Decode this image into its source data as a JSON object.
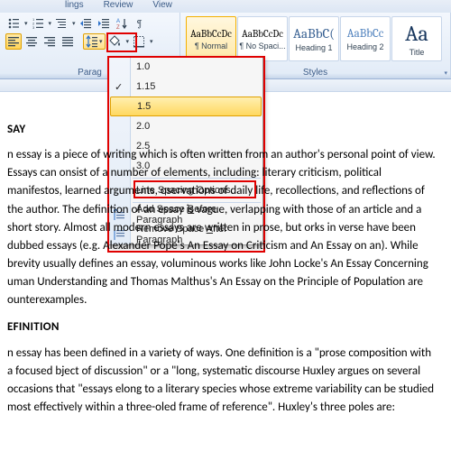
{
  "tabs": {
    "mailings": "lings",
    "review": "Review",
    "view": "View"
  },
  "ribbon": {
    "paragraph_label": "Parag",
    "styles_label": "Styles"
  },
  "styles": [
    {
      "preview": "AaBbCcDc",
      "name": "¶ Normal",
      "prevSize": "11px",
      "prevColor": "#000",
      "sel": true
    },
    {
      "preview": "AaBbCcDc",
      "name": "¶ No Spaci...",
      "prevSize": "11px",
      "prevColor": "#000"
    },
    {
      "preview": "AaBbC(",
      "name": "Heading 1",
      "prevSize": "15px",
      "prevColor": "#365f91"
    },
    {
      "preview": "AaBbCc",
      "name": "Heading 2",
      "prevSize": "13px",
      "prevColor": "#4f81bd"
    },
    {
      "preview": "Aa",
      "name": "Title",
      "prevSize": "24px",
      "prevColor": "#17365d"
    }
  ],
  "dropdown": {
    "items": [
      {
        "label": "1.0"
      },
      {
        "label": "1.15",
        "checked": true
      },
      {
        "label": "1.5",
        "hover": true
      },
      {
        "label": "2.0"
      },
      {
        "label": "2.5"
      },
      {
        "label": "3.0"
      }
    ],
    "line_spacing_options": "Line Spacing Options...",
    "add_before": "Add Space Before Paragraph",
    "add_before_accel": "B",
    "remove_after": "Remove Space After Paragraph",
    "remove_after_accel": "A"
  },
  "doc": {
    "h1": "SAY",
    "p1": "n essay is a piece of writing which is often written from an author's personal point of view. Essays can onsist of a number of elements, including: literary criticism, political manifestos, learned arguments, oservations of daily life, recollections, and reflections of the author. The definition of an essay is vague, verlapping with those of an article and a short story. Almost all modern essays are written in prose, but orks in verse have been dubbed essays (e.g. Alexander Pope's An Essay on Criticism and An Essay on an). While brevity usually defines an essay, voluminous works like John Locke's An Essay Concerning uman Understanding and Thomas Malthus's An Essay on the Principle of Population are ounterexamples.",
    "h2": "EFINITION",
    "p2": "n essay has been defined in a variety of ways. One definition is a \"prose composition with a focused bject of discussion\" or a \"long, systematic discourse Huxley argues on several occasions that \"essays elong to a literary species whose extreme variability can be studied most effectively within a three-oled frame of reference\". Huxley's three poles are:"
  }
}
